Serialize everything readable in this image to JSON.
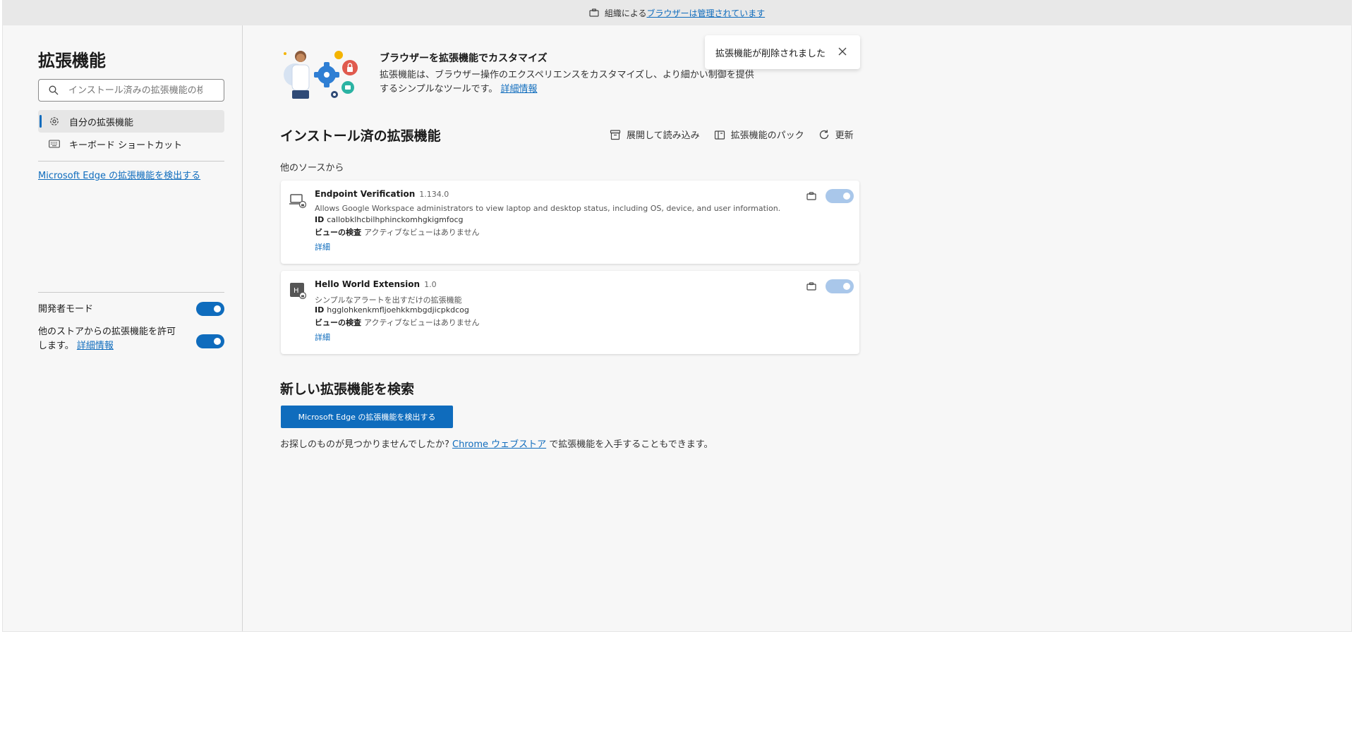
{
  "management_bar": {
    "prefix": "組織による",
    "link": "ブラウザーは管理されています"
  },
  "sidebar": {
    "title": "拡張機能",
    "search_placeholder": "インストール済みの拡張機能の検索",
    "nav": [
      {
        "label": "自分の拡張機能",
        "icon": "extension-gear-icon",
        "active": true
      },
      {
        "label": "キーボード ショートカット",
        "icon": "keyboard-icon",
        "active": false
      }
    ],
    "discover_link": "Microsoft Edge の拡張機能を検出する",
    "developer_mode_label": "開発者モード",
    "developer_mode_on": true,
    "allow_other_stores_label": "他のストアからの拡張機能を許可します。",
    "allow_other_stores_link": "詳細情報",
    "allow_other_stores_on": true
  },
  "hero": {
    "title": "ブラウザーを拡張機能でカスタマイズ",
    "description": "拡張機能は、ブラウザー操作のエクスペリエンスをカスタマイズし、より細かい制御を提供するシンプルなツールです。",
    "link": "詳細情報"
  },
  "toast": {
    "message": "拡張機能が削除されました"
  },
  "installed": {
    "title": "インストール済の拡張機能",
    "tools": [
      {
        "label": "展開して読み込み",
        "icon": "box-open-icon"
      },
      {
        "label": "拡張機能のパック",
        "icon": "pack-icon"
      },
      {
        "label": "更新",
        "icon": "refresh-icon"
      }
    ],
    "source_label": "他のソースから",
    "id_label": "ID",
    "inspect_label": "ビューの検査",
    "extensions": [
      {
        "name": "Endpoint Verification",
        "version": "1.134.0",
        "description": "Allows Google Workspace administrators to view laptop and desktop status, including OS, device, and user information.",
        "id": "callobklhcbilhphinckomhgkigmfocg",
        "inspect_value": "アクティブなビューはありません",
        "details": "詳細",
        "enabled": true,
        "managed": true
      },
      {
        "name": "Hello World Extension",
        "version": "1.0",
        "description": "シンプルなアラートを出すだけの拡張機能",
        "id": "hgglohkenkmfljoehkkmbgdjicpkdcog",
        "inspect_value": "アクティブなビューはありません",
        "details": "詳細",
        "enabled": true,
        "managed": true
      }
    ]
  },
  "find_new": {
    "title": "新しい拡張機能を検索",
    "button": "Microsoft Edge の拡張機能を検出する",
    "note_prefix": "お探しのものが見つかりませんでしたか?",
    "note_link": "Chrome ウェブストア",
    "note_suffix": "で拡張機能を入手することもできます。"
  },
  "colors": {
    "accent": "#0f6cbd",
    "page_bg": "#f7f7f7",
    "card_bg": "#ffffff"
  }
}
